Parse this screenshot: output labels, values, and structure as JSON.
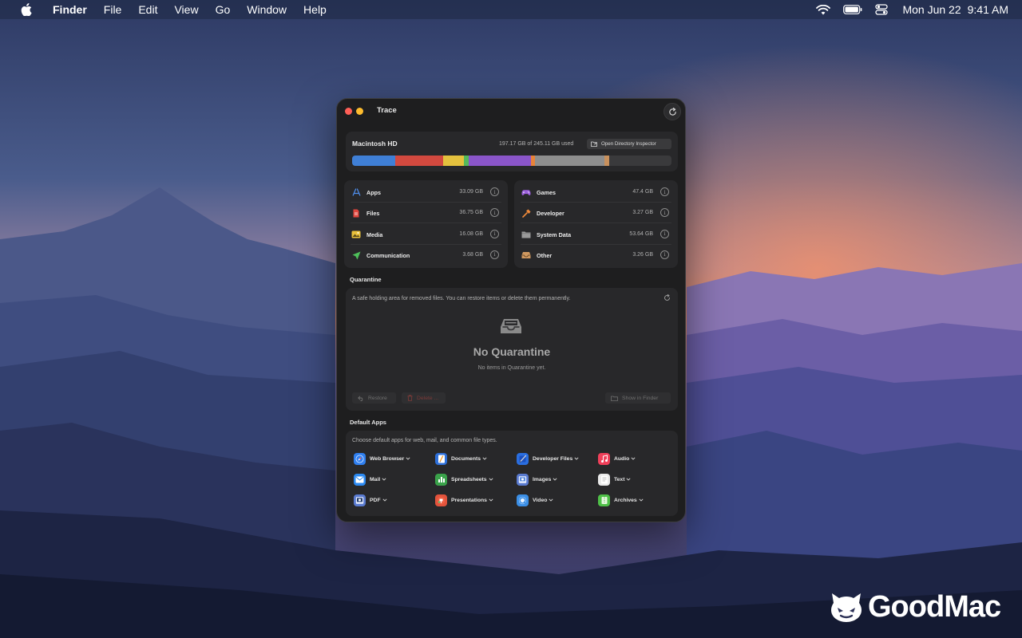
{
  "menubar": {
    "app_name": "Finder",
    "menus": [
      "File",
      "Edit",
      "View",
      "Go",
      "Window",
      "Help"
    ],
    "date": "Mon Jun 22",
    "time": "9:41 AM"
  },
  "window": {
    "title": "Trace",
    "disk": {
      "name": "Macintosh HD",
      "used_text": "197.17 GB of 245.11 GB used",
      "inspector_button": "Open Directory Inspector",
      "segments": [
        {
          "name": "Apps",
          "color": "#3f7fd6",
          "gb": 33.09
        },
        {
          "name": "Files",
          "color": "#d2493f",
          "gb": 36.75
        },
        {
          "name": "Media",
          "color": "#e4c13e",
          "gb": 16.08
        },
        {
          "name": "Communication",
          "color": "#55b95a",
          "gb": 3.68
        },
        {
          "name": "Games",
          "color": "#8a55c9",
          "gb": 47.4
        },
        {
          "name": "Developer",
          "color": "#e8833a",
          "gb": 3.27
        },
        {
          "name": "System Data",
          "color": "#8e8e8e",
          "gb": 53.64
        },
        {
          "name": "Other",
          "color": "#c8905c",
          "gb": 3.26
        }
      ],
      "total_gb": 245.11
    },
    "categories_left": [
      {
        "label": "Apps",
        "size": "33.09 GB",
        "icon": "app-store-icon"
      },
      {
        "label": "Files",
        "size": "36.75 GB",
        "icon": "document-icon"
      },
      {
        "label": "Media",
        "size": "16.08 GB",
        "icon": "photo-icon"
      },
      {
        "label": "Communication",
        "size": "3.68 GB",
        "icon": "paper-plane-icon"
      }
    ],
    "categories_right": [
      {
        "label": "Games",
        "size": "47.4 GB",
        "icon": "gamepad-icon"
      },
      {
        "label": "Developer",
        "size": "3.27 GB",
        "icon": "hammer-icon"
      },
      {
        "label": "System Data",
        "size": "53.64 GB",
        "icon": "folder-icon"
      },
      {
        "label": "Other",
        "size": "3.26 GB",
        "icon": "tray-icon"
      }
    ],
    "info_glyph": "i",
    "quarantine": {
      "title": "Quarantine",
      "description": "A safe holding area for removed files. You can restore items or delete them permanently.",
      "empty_title": "No Quarantine",
      "empty_subtitle": "No items in Quarantine yet.",
      "restore_label": "Restore",
      "delete_label": "Delete ...",
      "finder_label": "Show in Finder"
    },
    "default_apps": {
      "title": "Default Apps",
      "description": "Choose default apps for web, mail, and common file types.",
      "items": [
        {
          "label": "Web Browser",
          "icon": "safari-icon",
          "color": "#2f7ff0"
        },
        {
          "label": "Documents",
          "icon": "pages-icon",
          "color": "#2e6fd8"
        },
        {
          "label": "Developer Files",
          "icon": "xcode-icon",
          "color": "#2a6ee0"
        },
        {
          "label": "Audio",
          "icon": "music-icon",
          "color": "#f0405a"
        },
        {
          "label": "Mail",
          "icon": "mail-icon",
          "color": "#2c8af2"
        },
        {
          "label": "Spreadsheets",
          "icon": "numbers-icon",
          "color": "#3aa24a"
        },
        {
          "label": "Images",
          "icon": "preview-icon",
          "color": "#5a7bd0"
        },
        {
          "label": "Text",
          "icon": "textedit-icon",
          "color": "#e9e9e9"
        },
        {
          "label": "PDF",
          "icon": "preview-pdf-icon",
          "color": "#5a7bd0"
        },
        {
          "label": "Presentations",
          "icon": "keynote-icon",
          "color": "#e2533c"
        },
        {
          "label": "Video",
          "icon": "quicktime-icon",
          "color": "#3b8fe6"
        },
        {
          "label": "Archives",
          "icon": "archive-utility-icon",
          "color": "#4fc048"
        }
      ]
    }
  },
  "watermark": "GoodMac"
}
